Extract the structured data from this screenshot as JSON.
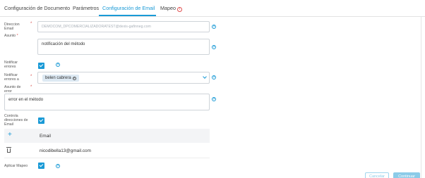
{
  "tabs": [
    {
      "label": "Configuración de Documento"
    },
    {
      "label": "Parámetros"
    },
    {
      "label": "Configuración de Email"
    },
    {
      "label": "Mapeo"
    }
  ],
  "active_tab": "Configuración de Email",
  "form": {
    "direccion_email": {
      "label": "Direccion Email",
      "value": "DEMOCOM_DPCOMERCIALIZADORATEST@dexis-gafinneg.com"
    },
    "asunto": {
      "label": "Asunto",
      "value": "notificación del método"
    },
    "notificar_errores": {
      "label": "Notificar errores",
      "checked": true
    },
    "notificar_errores_a": {
      "label": "Notificar errores a",
      "chips": [
        "belen cabrera"
      ]
    },
    "asunto_de_error": {
      "label": "Asunto de error",
      "value": "error en el método"
    },
    "controla_direcciones": {
      "label": "Controla direcciones de Email",
      "checked": true
    },
    "aplicar_mapeo": {
      "label": "Aplicar Mapeo",
      "checked": true
    }
  },
  "email_table": {
    "header": "Email",
    "rows": [
      "nicodibella13@gmail.com"
    ]
  },
  "buttons": {
    "cancel": "Cancelar",
    "confirm": "Continuar"
  },
  "colors": {
    "accent": "#1a9ad6",
    "required": "#d9534f"
  }
}
